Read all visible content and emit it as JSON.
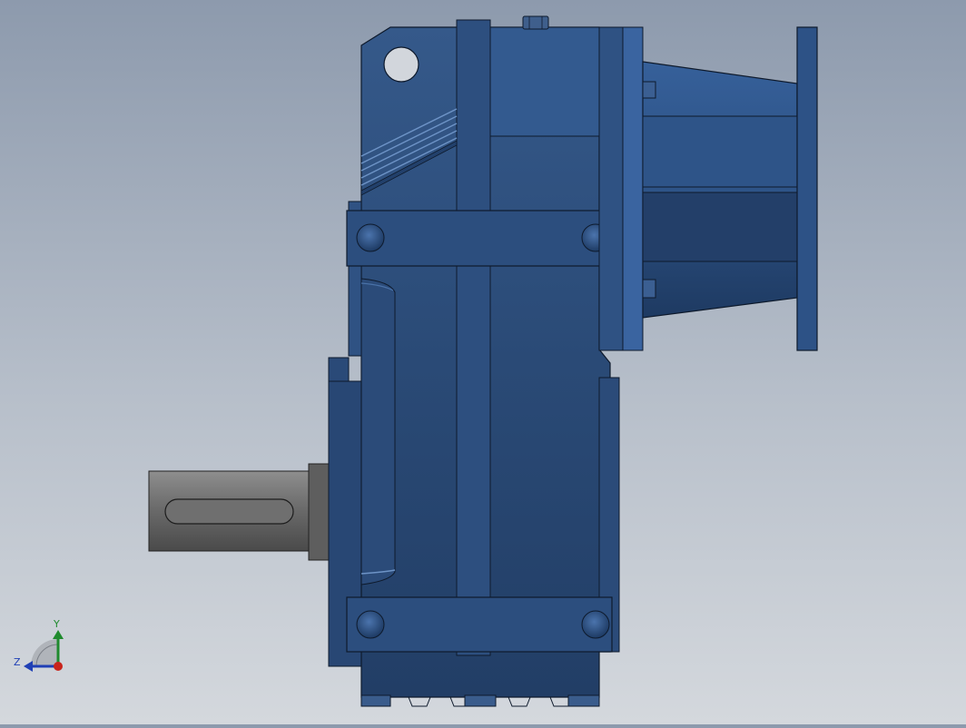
{
  "viewport": {
    "background_top": "#8d9aad",
    "background_bottom": "#d4d8dd"
  },
  "model": {
    "body_color": "#2c4d7a",
    "body_highlight": "#3d6499",
    "body_shadow": "#1d3557",
    "edge_color": "#0e1a2c",
    "shaft_color": "#6b6b6b",
    "shaft_highlight": "#8a8a8a"
  },
  "triad": {
    "y_label": "Y",
    "z_label": "Z",
    "y_color": "#1f8a2e",
    "z_color": "#1f3fb5",
    "x_color": "#c8241c"
  }
}
